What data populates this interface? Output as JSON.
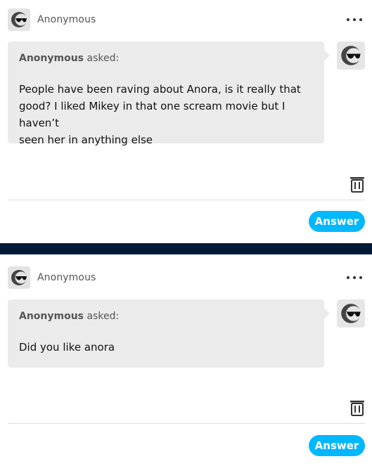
{
  "posts": [
    {
      "username": "Anonymous",
      "asker_name": "Anonymous",
      "asked_label": "asked:",
      "question_lines": [
        "People have been raving about Anora, is it really that",
        "good? I liked Mikey in that one scream movie but I haven’t",
        "seen her in anything else"
      ],
      "answer_label": "Answer"
    },
    {
      "username": "Anonymous",
      "asker_name": "Anonymous",
      "asked_label": "asked:",
      "question_lines": [
        "Did you like anora"
      ],
      "answer_label": "Answer"
    }
  ],
  "colors": {
    "accent": "#00b8ff",
    "separator": "#001935",
    "bubble": "#ebebeb"
  },
  "icons": {
    "avatar": "sunglasses-face-icon",
    "more": "more-dots-icon",
    "trash": "trash-icon"
  }
}
